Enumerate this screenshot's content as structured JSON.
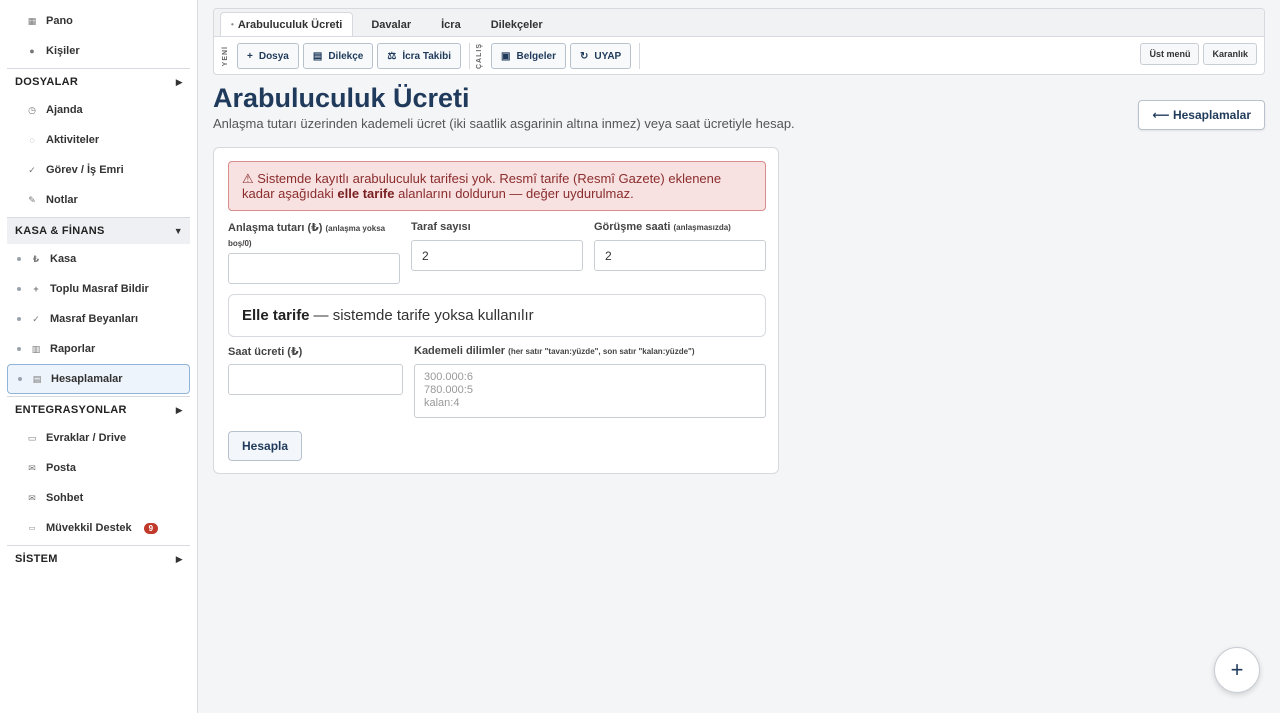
{
  "sidebar": {
    "top_items": [
      {
        "label": "Pano",
        "icon": "▦"
      },
      {
        "label": "Kişiler",
        "icon": "●"
      }
    ],
    "dosyalar": {
      "label": "DOSYALAR",
      "arrow": "▶",
      "items": [
        {
          "label": "Ajanda",
          "icon": "◷"
        },
        {
          "label": "Aktiviteler",
          "icon": "◌"
        },
        {
          "label": "Görev / İş Emri",
          "icon": "✓"
        },
        {
          "label": "Notlar",
          "icon": "✎"
        }
      ]
    },
    "kasa": {
      "label": "KASA & FİNANS",
      "arrow": "▼",
      "items": [
        {
          "label": "Kasa",
          "icon": "₺"
        },
        {
          "label": "Toplu Masraf Bildir",
          "icon": "+"
        },
        {
          "label": "Masraf Beyanları",
          "icon": "✓"
        },
        {
          "label": "Raporlar",
          "icon": "▥"
        },
        {
          "label": "Hesaplamalar",
          "icon": "▤"
        }
      ]
    },
    "entegrasyonlar": {
      "label": "ENTEGRASYONLAR",
      "arrow": "▶",
      "items": [
        {
          "label": "Evraklar / Drive",
          "icon": "▭"
        },
        {
          "label": "Posta",
          "icon": "✉"
        },
        {
          "label": "Sohbet",
          "icon": "✉"
        },
        {
          "label": "Müvekkil Destek",
          "icon": "💬",
          "badge": "9"
        }
      ]
    },
    "sistem": {
      "label": "SİSTEM",
      "arrow": "▶"
    }
  },
  "topbar": {
    "tabs": [
      "Arabuluculuk Ücreti",
      "Davalar",
      "İcra",
      "Dilekçeler"
    ],
    "active_tab_dot": "•",
    "yeni_label": "YENİ",
    "calis_label": "ÇALIŞ",
    "buttons": [
      {
        "label": "Dosya",
        "icon": "+"
      },
      {
        "label": "Dilekçe",
        "icon": "▤"
      },
      {
        "label": "İcra Takibi",
        "icon": "⚖"
      }
    ],
    "buttons2": [
      {
        "label": "Belgeler",
        "icon": "▣"
      },
      {
        "label": "UYAP",
        "icon": "↻"
      }
    ],
    "right_buttons": [
      "Üst menü",
      "Karanlık"
    ]
  },
  "page": {
    "title": "Arabuluculuk Ücreti",
    "subtitle": "Anlaşma tutarı üzerinden kademeli ücret (iki saatlik asgarinin altına inmez) veya saat ücretiyle hesap.",
    "back_button": "⟵ Hesaplamalar"
  },
  "form": {
    "alert_pre": "⚠ Sistemde kayıtlı arabuluculuk tarifesi yok. Resmî tarife (Resmî Gazete) eklenene kadar aşağıdaki ",
    "alert_bold": "elle tarife",
    "alert_post": " alanlarını doldurun — değer uydurulmaz.",
    "anlasma_label": "Anlaşma tutarı (₺)",
    "anlasma_hint": "(anlaşma yoksa boş/0)",
    "anlasma_value": "",
    "taraf_label": "Taraf sayısı",
    "taraf_value": "2",
    "gorusme_label": "Görüşme saati",
    "gorusme_hint": "(anlaşmasızda)",
    "gorusme_value": "2",
    "elle_bold": "Elle tarife",
    "elle_text": "— sistemde tarife yoksa kullanılır",
    "saat_label": "Saat ücreti (₺)",
    "saat_value": "",
    "kademe_label": "Kademeli dilimler",
    "kademe_hint": "(her satır \"tavan:yüzde\", son satır \"kalan:yüzde\")",
    "kademe_placeholder": "300.000:6\n780.000:5\nkalan:4",
    "submit": "Hesapla"
  },
  "fab_icon": "+"
}
